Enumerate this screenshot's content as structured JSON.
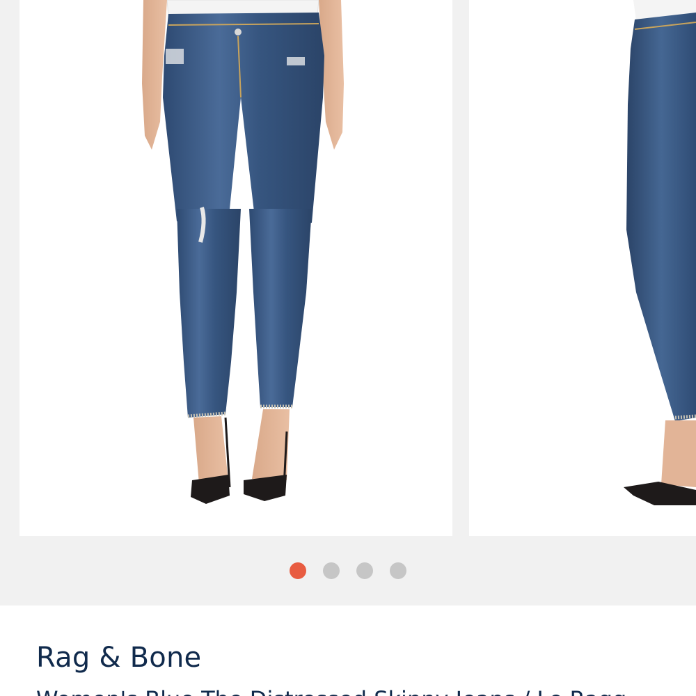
{
  "carousel": {
    "slides": [
      {
        "icon": "product-photo-front"
      },
      {
        "icon": "product-photo-side"
      }
    ],
    "dots": [
      "slide-1",
      "slide-2",
      "slide-3",
      "slide-4"
    ],
    "active_index": 0,
    "colors": {
      "active_dot": "#e85c41",
      "inactive_dot": "#c6c6c6",
      "denim": "#3d5a86"
    }
  },
  "product": {
    "brand": "Rag & Bone",
    "title": "Women's Blue The Distressed Skinny Jeans / Le Ragg"
  }
}
